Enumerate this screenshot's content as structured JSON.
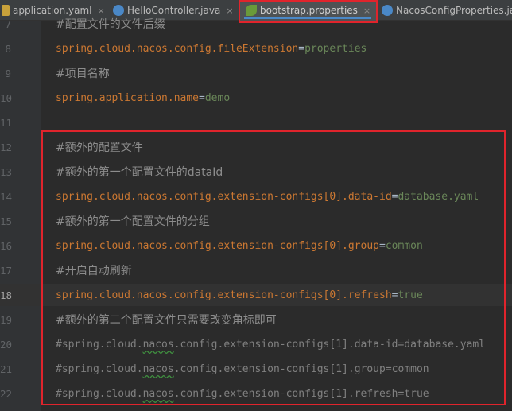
{
  "tabs": [
    {
      "label": "application.yaml",
      "icon": "yaml-icon",
      "close": "×"
    },
    {
      "label": "HelloController.java",
      "icon": "class-icon",
      "close": "×"
    },
    {
      "label": "bootstrap.properties",
      "icon": "spring-leaf-icon",
      "close": "×"
    },
    {
      "label": "NacosConfigProperties.ja",
      "icon": "class-icon",
      "close": ""
    }
  ],
  "colors": {
    "key": "#cc7832",
    "value": "#6a8759",
    "comment": "#808080",
    "highlight_box": "#e0242c"
  },
  "line_numbers": [
    "7",
    "8",
    "9",
    "10",
    "11",
    "12",
    "13",
    "14",
    "15",
    "16",
    "17",
    "18",
    "19",
    "20",
    "21",
    "22"
  ],
  "lines": [
    {
      "type": "comment",
      "text": "#配置文件的文件后缀"
    },
    {
      "type": "prop",
      "key": "spring.cloud.nacos.config.fileExtension",
      "eq": "=",
      "value": "properties"
    },
    {
      "type": "comment",
      "text": "#项目名称"
    },
    {
      "type": "prop",
      "key": "spring.application.name",
      "eq": "=",
      "value": "demo"
    },
    {
      "type": "blank",
      "text": ""
    },
    {
      "type": "comment",
      "text": "#额外的配置文件"
    },
    {
      "type": "comment",
      "text": "#额外的第一个配置文件的dataId"
    },
    {
      "type": "prop",
      "key": "spring.cloud.nacos.config.extension-configs[0].data-id",
      "eq": "=",
      "value": "database.yaml"
    },
    {
      "type": "comment",
      "text": "#额外的第一个配置文件的分组"
    },
    {
      "type": "prop",
      "key": "spring.cloud.nacos.config.extension-configs[0].group",
      "eq": "=",
      "value": "common"
    },
    {
      "type": "comment",
      "text": "#开启自动刷新"
    },
    {
      "type": "prop",
      "key": "spring.cloud.nacos.config.extension-configs[0].refresh",
      "eq": "=",
      "value": "true"
    },
    {
      "type": "comment",
      "text": "#额外的第二个配置文件只需要改变角标即可"
    },
    {
      "type": "comment",
      "text": "#spring.cloud.nacos.config.extension-configs[1].data-id=database.yaml"
    },
    {
      "type": "comment",
      "text": "#spring.cloud.nacos.config.extension-configs[1].group=common"
    },
    {
      "type": "comment",
      "text": "#spring.cloud.nacos.config.extension-configs[1].refresh=true"
    }
  ]
}
